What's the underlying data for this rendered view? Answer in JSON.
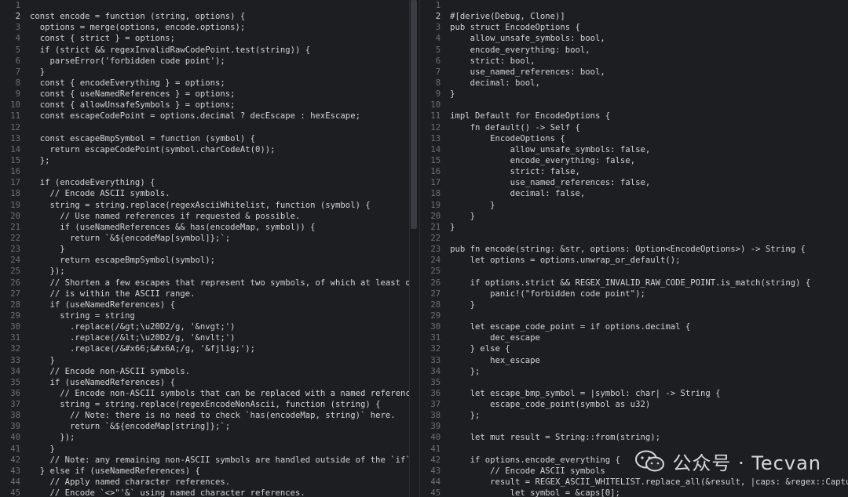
{
  "left": {
    "lines": [
      {
        "n": "1",
        "text": ""
      },
      {
        "n": "2",
        "text": "const encode = function (string, options) {"
      },
      {
        "n": "3",
        "text": "  options = merge(options, encode.options);"
      },
      {
        "n": "4",
        "text": "  const { strict } = options;"
      },
      {
        "n": "5",
        "text": "  if (strict && regexInvalidRawCodePoint.test(string)) {"
      },
      {
        "n": "6",
        "text": "    parseError('forbidden code point');"
      },
      {
        "n": "7",
        "text": "  }"
      },
      {
        "n": "8",
        "text": "  const { encodeEverything } = options;"
      },
      {
        "n": "9",
        "text": "  const { useNamedReferences } = options;"
      },
      {
        "n": "10",
        "text": "  const { allowUnsafeSymbols } = options;"
      },
      {
        "n": "11",
        "text": "  const escapeCodePoint = options.decimal ? decEscape : hexEscape;"
      },
      {
        "n": "12",
        "text": ""
      },
      {
        "n": "13",
        "text": "  const escapeBmpSymbol = function (symbol) {"
      },
      {
        "n": "14",
        "text": "    return escapeCodePoint(symbol.charCodeAt(0));"
      },
      {
        "n": "15",
        "text": "  };"
      },
      {
        "n": "16",
        "text": ""
      },
      {
        "n": "17",
        "text": "  if (encodeEverything) {"
      },
      {
        "n": "18",
        "text": "    // Encode ASCII symbols."
      },
      {
        "n": "19",
        "text": "    string = string.replace(regexAsciiWhitelist, function (symbol) {"
      },
      {
        "n": "20",
        "text": "      // Use named references if requested & possible."
      },
      {
        "n": "21",
        "text": "      if (useNamedReferences && has(encodeMap, symbol)) {"
      },
      {
        "n": "22",
        "text": "        return `&${encodeMap[symbol]};`;"
      },
      {
        "n": "23",
        "text": "      }"
      },
      {
        "n": "24",
        "text": "      return escapeBmpSymbol(symbol);"
      },
      {
        "n": "25",
        "text": "    });"
      },
      {
        "n": "26",
        "text": "    // Shorten a few escapes that represent two symbols, of which at least one"
      },
      {
        "n": "27",
        "text": "    // is within the ASCII range."
      },
      {
        "n": "28",
        "text": "    if (useNamedReferences) {"
      },
      {
        "n": "29",
        "text": "      string = string"
      },
      {
        "n": "30",
        "text": "        .replace(/&gt;\\u20D2/g, '&nvgt;')"
      },
      {
        "n": "31",
        "text": "        .replace(/&lt;\\u20D2/g, '&nvlt;')"
      },
      {
        "n": "32",
        "text": "        .replace(/&#x66;&#x6A;/g, '&fjlig;');"
      },
      {
        "n": "33",
        "text": "    }"
      },
      {
        "n": "34",
        "text": "    // Encode non-ASCII symbols."
      },
      {
        "n": "35",
        "text": "    if (useNamedReferences) {"
      },
      {
        "n": "36",
        "text": "      // Encode non-ASCII symbols that can be replaced with a named reference."
      },
      {
        "n": "37",
        "text": "      string = string.replace(regexEncodeNonAscii, function (string) {"
      },
      {
        "n": "38",
        "text": "        // Note: there is no need to check `has(encodeMap, string)` here."
      },
      {
        "n": "39",
        "text": "        return `&${encodeMap[string]};`;"
      },
      {
        "n": "40",
        "text": "      });"
      },
      {
        "n": "41",
        "text": "    }"
      },
      {
        "n": "42",
        "text": "    // Note: any remaining non-ASCII symbols are handled outside of the `if`."
      },
      {
        "n": "43",
        "text": "  } else if (useNamedReferences) {"
      },
      {
        "n": "44",
        "text": "    // Apply named character references."
      },
      {
        "n": "45",
        "text": "    // Encode `<>\"'&` using named character references."
      }
    ]
  },
  "right": {
    "lines": [
      {
        "n": "1",
        "text": ""
      },
      {
        "n": "2",
        "text": "#[derive(Debug, Clone)]"
      },
      {
        "n": "3",
        "text": "pub struct EncodeOptions {"
      },
      {
        "n": "4",
        "text": "    allow_unsafe_symbols: bool,"
      },
      {
        "n": "5",
        "text": "    encode_everything: bool,"
      },
      {
        "n": "6",
        "text": "    strict: bool,"
      },
      {
        "n": "7",
        "text": "    use_named_references: bool,"
      },
      {
        "n": "8",
        "text": "    decimal: bool,"
      },
      {
        "n": "9",
        "text": "}"
      },
      {
        "n": "10",
        "text": ""
      },
      {
        "n": "11",
        "text": "impl Default for EncodeOptions {"
      },
      {
        "n": "12",
        "text": "    fn default() -> Self {"
      },
      {
        "n": "13",
        "text": "        EncodeOptions {"
      },
      {
        "n": "14",
        "text": "            allow_unsafe_symbols: false,"
      },
      {
        "n": "15",
        "text": "            encode_everything: false,"
      },
      {
        "n": "16",
        "text": "            strict: false,"
      },
      {
        "n": "17",
        "text": "            use_named_references: false,"
      },
      {
        "n": "18",
        "text": "            decimal: false,"
      },
      {
        "n": "19",
        "text": "        }"
      },
      {
        "n": "20",
        "text": "    }"
      },
      {
        "n": "21",
        "text": "}"
      },
      {
        "n": "22",
        "text": ""
      },
      {
        "n": "23",
        "text": "pub fn encode(string: &str, options: Option<EncodeOptions>) -> String {"
      },
      {
        "n": "24",
        "text": "    let options = options.unwrap_or_default();"
      },
      {
        "n": "25",
        "text": ""
      },
      {
        "n": "26",
        "text": "    if options.strict && REGEX_INVALID_RAW_CODE_POINT.is_match(string) {"
      },
      {
        "n": "27",
        "text": "        panic!(\"forbidden code point\");"
      },
      {
        "n": "28",
        "text": "    }"
      },
      {
        "n": "29",
        "text": ""
      },
      {
        "n": "30",
        "text": "    let escape_code_point = if options.decimal {"
      },
      {
        "n": "31",
        "text": "        dec_escape"
      },
      {
        "n": "32",
        "text": "    } else {"
      },
      {
        "n": "33",
        "text": "        hex_escape"
      },
      {
        "n": "34",
        "text": "    };"
      },
      {
        "n": "35",
        "text": ""
      },
      {
        "n": "36",
        "text": "    let escape_bmp_symbol = |symbol: char| -> String {"
      },
      {
        "n": "37",
        "text": "        escape_code_point(symbol as u32)"
      },
      {
        "n": "38",
        "text": "    };"
      },
      {
        "n": "39",
        "text": ""
      },
      {
        "n": "40",
        "text": "    let mut result = String::from(string);"
      },
      {
        "n": "41",
        "text": ""
      },
      {
        "n": "42",
        "text": "    if options.encode_everything {"
      },
      {
        "n": "43",
        "text": "        // Encode ASCII symbols"
      },
      {
        "n": "44",
        "text": "        result = REGEX_ASCII_WHITELIST.replace_all(&result, |caps: &regex::Captures| {"
      },
      {
        "n": "45",
        "text": "            let symbol = &caps[0];"
      }
    ]
  },
  "watermark": {
    "text": "公众号 · Tecvan",
    "icon": "wechat-icon"
  },
  "colors": {
    "background": "#1d1e21",
    "text": "#d4d4d4",
    "line_number": "#6e7075"
  }
}
